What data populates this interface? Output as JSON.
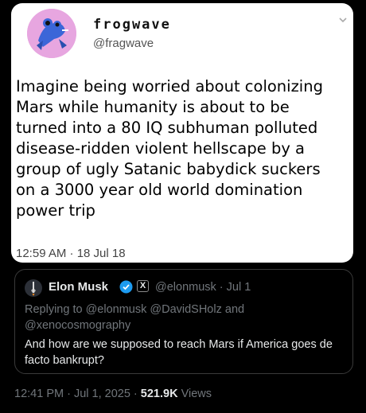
{
  "tweet": {
    "display_name": "frogwave",
    "handle": "@fragwave",
    "text": "Imagine being worried about colonizing\nMars while humanity is about to be\nturned into a 80 IQ subhuman polluted\ndisease-ridden violent hellscape by a\ngroup of ugly Satanic babydick suckers\non a 3000 year old world domination\npower trip",
    "timestamp": "12:59 AM · 18 Jul 18",
    "avatar_icon": "frog-avatar-icon",
    "menu_icon": "chevron-down-icon"
  },
  "quote": {
    "name": "Elon Musk",
    "handle_meta": "@elonmusk · Jul 1",
    "xbadge": "X",
    "replying": "Replying to @elonmusk @DavidSHolz and @xenocosmography",
    "text": "And how are we supposed to reach Mars if America goes de facto bankrupt?",
    "verified_color": "#1d9bf0"
  },
  "footer": {
    "time": "12:41 PM · Jul 1, 2025 · ",
    "views_count": "521.9K",
    "views_label": " Views"
  },
  "colors": {
    "background": "#000000",
    "card": "#ffffff",
    "muted": "#71767b"
  }
}
